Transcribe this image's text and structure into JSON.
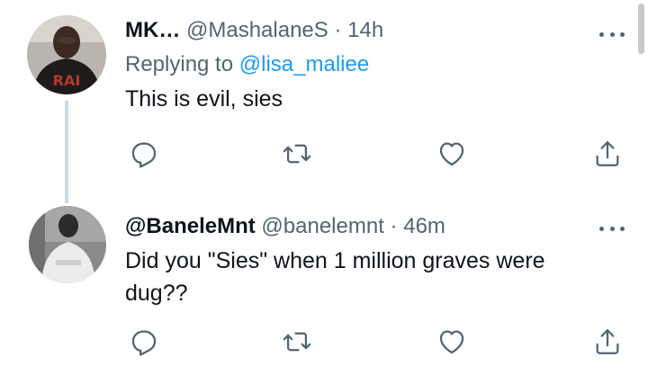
{
  "tweets": [
    {
      "name": "MK…",
      "handle": "@MashalaneS",
      "separator": "·",
      "time": "14h",
      "replying_prefix": "Replying to ",
      "replying_to": "@lisa_maliee",
      "text": "This is evil, sies",
      "avatar_text": "RAI"
    },
    {
      "name": "@BaneleMnt",
      "handle": "@banelemnt",
      "separator": "·",
      "time": "46m",
      "text_lines": [
        "Did you \"Sies\" when 1 million graves were",
        "dug??"
      ]
    }
  ],
  "icons": [
    "reply-icon",
    "retweet-icon",
    "like-icon",
    "share-icon",
    "more-icon"
  ],
  "colors": {
    "link": "#1d9bf0",
    "secondary": "#536471",
    "text": "#0f1419",
    "thread_line": "#cfd9de"
  }
}
